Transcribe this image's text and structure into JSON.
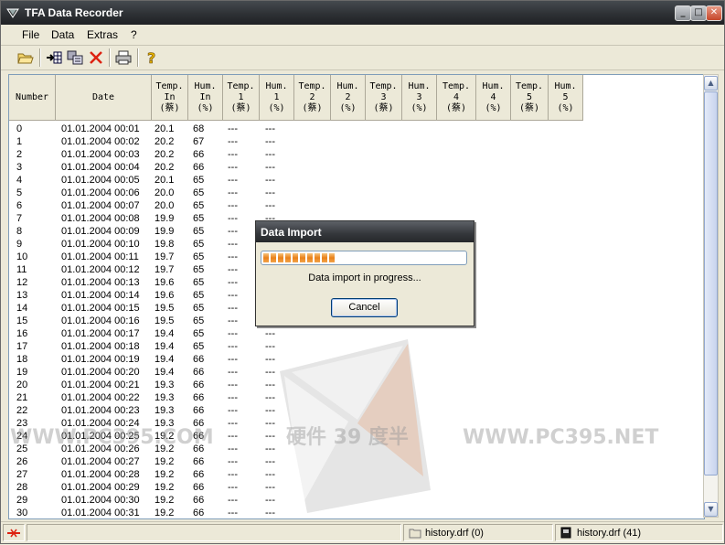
{
  "window": {
    "title": "TFA Data Recorder"
  },
  "menu": [
    {
      "label": "File"
    },
    {
      "label": "Data"
    },
    {
      "label": "Extras"
    },
    {
      "label": "?"
    }
  ],
  "columns": [
    "Number",
    "Date",
    "Temp.\nIn\n(蔡)",
    "Hum.\nIn\n(%)",
    "Temp.\n1\n(蔡)",
    "Hum.\n1\n(%)",
    "Temp.\n2\n(蔡)",
    "Hum.\n2\n(%)",
    "Temp.\n3\n(蔡)",
    "Hum.\n3\n(%)",
    "Temp.\n4\n(蔡)",
    "Hum.\n4\n(%)",
    "Temp.\n5\n(蔡)",
    "Hum.\n5\n(%)"
  ],
  "rows": [
    [
      "0",
      "01.01.2004 00:01",
      "20.1",
      "68",
      "---",
      "---"
    ],
    [
      "1",
      "01.01.2004 00:02",
      "20.2",
      "67",
      "---",
      "---"
    ],
    [
      "2",
      "01.01.2004 00:03",
      "20.2",
      "66",
      "---",
      "---"
    ],
    [
      "3",
      "01.01.2004 00:04",
      "20.2",
      "66",
      "---",
      "---"
    ],
    [
      "4",
      "01.01.2004 00:05",
      "20.1",
      "65",
      "---",
      "---"
    ],
    [
      "5",
      "01.01.2004 00:06",
      "20.0",
      "65",
      "---",
      "---"
    ],
    [
      "6",
      "01.01.2004 00:07",
      "20.0",
      "65",
      "---",
      "---"
    ],
    [
      "7",
      "01.01.2004 00:08",
      "19.9",
      "65",
      "---",
      "---"
    ],
    [
      "8",
      "01.01.2004 00:09",
      "19.9",
      "65",
      "---",
      "---"
    ],
    [
      "9",
      "01.01.2004 00:10",
      "19.8",
      "65",
      "---",
      "---"
    ],
    [
      "10",
      "01.01.2004 00:11",
      "19.7",
      "65",
      "---",
      "---"
    ],
    [
      "11",
      "01.01.2004 00:12",
      "19.7",
      "65",
      "---",
      "---"
    ],
    [
      "12",
      "01.01.2004 00:13",
      "19.6",
      "65",
      "---",
      "---"
    ],
    [
      "13",
      "01.01.2004 00:14",
      "19.6",
      "65",
      "---",
      "---"
    ],
    [
      "14",
      "01.01.2004 00:15",
      "19.5",
      "65",
      "---",
      "---"
    ],
    [
      "15",
      "01.01.2004 00:16",
      "19.5",
      "65",
      "---",
      "---"
    ],
    [
      "16",
      "01.01.2004 00:17",
      "19.4",
      "65",
      "---",
      "---"
    ],
    [
      "17",
      "01.01.2004 00:18",
      "19.4",
      "65",
      "---",
      "---"
    ],
    [
      "18",
      "01.01.2004 00:19",
      "19.4",
      "66",
      "---",
      "---"
    ],
    [
      "19",
      "01.01.2004 00:20",
      "19.4",
      "66",
      "---",
      "---"
    ],
    [
      "20",
      "01.01.2004 00:21",
      "19.3",
      "66",
      "---",
      "---"
    ],
    [
      "21",
      "01.01.2004 00:22",
      "19.3",
      "66",
      "---",
      "---"
    ],
    [
      "22",
      "01.01.2004 00:23",
      "19.3",
      "66",
      "---",
      "---"
    ],
    [
      "23",
      "01.01.2004 00:24",
      "19.3",
      "66",
      "---",
      "---"
    ],
    [
      "24",
      "01.01.2004 00:25",
      "19.2",
      "66",
      "---",
      "---"
    ],
    [
      "25",
      "01.01.2004 00:26",
      "19.2",
      "66",
      "---",
      "---"
    ],
    [
      "26",
      "01.01.2004 00:27",
      "19.2",
      "66",
      "---",
      "---"
    ],
    [
      "27",
      "01.01.2004 00:28",
      "19.2",
      "66",
      "---",
      "---"
    ],
    [
      "28",
      "01.01.2004 00:29",
      "19.2",
      "66",
      "---",
      "---"
    ],
    [
      "29",
      "01.01.2004 00:30",
      "19.2",
      "66",
      "---",
      "---"
    ],
    [
      "30",
      "01.01.2004 00:31",
      "19.2",
      "66",
      "---",
      "---"
    ]
  ],
  "dialog": {
    "title": "Data Import",
    "message": "Data import in progress...",
    "cancel_label": "Cancel",
    "progress_fraction": 0.35
  },
  "status": {
    "panel1": "history.drf (0)",
    "panel2": "history.drf (41)"
  },
  "watermark": {
    "left": "WWW.PC395.COM",
    "middle": "硬件 39 度半",
    "right": "WWW.PC395.NET"
  },
  "colors": {
    "accent": "#e8811a",
    "titlebar": "#2e3135"
  }
}
